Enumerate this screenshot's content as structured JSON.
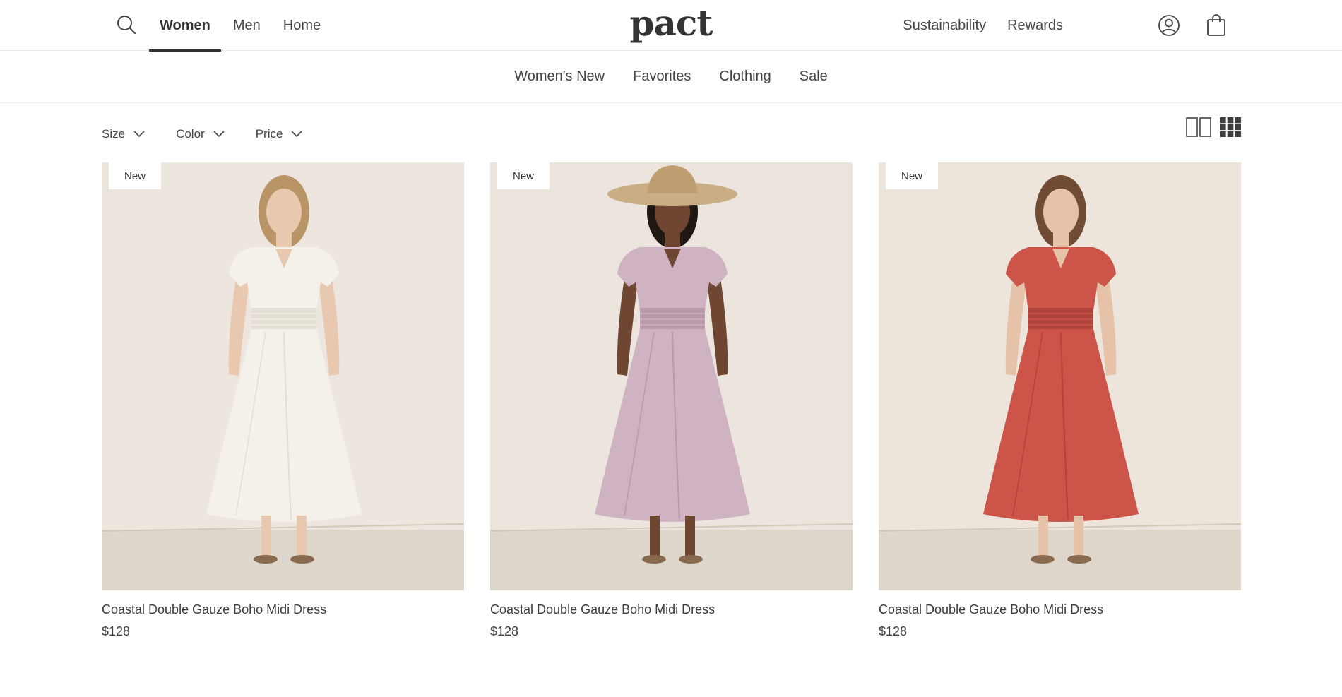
{
  "header": {
    "search_icon": "search-icon",
    "dept_tabs": [
      {
        "label": "Women",
        "active": true
      },
      {
        "label": "Men",
        "active": false
      },
      {
        "label": "Home",
        "active": false
      }
    ],
    "logo_text": "pact",
    "util_links": [
      "Sustainability",
      "Rewards"
    ],
    "account_icon": "user-icon",
    "cart_icon": "shopping-bag-icon"
  },
  "subnav": {
    "links": [
      "Women's New",
      "Favorites",
      "Clothing",
      "Sale"
    ]
  },
  "filters": [
    {
      "label": "Size"
    },
    {
      "label": "Color"
    },
    {
      "label": "Price"
    }
  ],
  "view_toggle": {
    "two_column_icon": "two-column-grid-icon",
    "three_column_icon": "three-column-grid-icon",
    "selected": "three-column"
  },
  "products": [
    {
      "badge": "New",
      "title": "Coastal Double Gauze Boho Midi Dress",
      "price": "$128",
      "dress_color": "#f3f1ea",
      "dress_shade": "#e2ded3",
      "bg": "#ece6de",
      "skin": "#e8c8ae",
      "hair": "#b89466",
      "floor": "#ddd6ca",
      "hat": false
    },
    {
      "badge": "New",
      "title": "Coastal Double Gauze Boho Midi Dress",
      "price": "$128",
      "dress_color": "#cfb3c3",
      "dress_shade": "#b99aab",
      "bg": "#ebe5de",
      "skin": "#6e4631",
      "hair": "#1f1712",
      "floor": "#ddd6ca",
      "hat": true
    },
    {
      "badge": "New",
      "title": "Coastal Double Gauze Boho Midi Dress",
      "price": "$128",
      "dress_color": "#cc5448",
      "dress_shade": "#b0443a",
      "bg": "#ede4db",
      "skin": "#e5c2a8",
      "hair": "#6f4c33",
      "floor": "#ded6ca",
      "hat": false
    }
  ]
}
